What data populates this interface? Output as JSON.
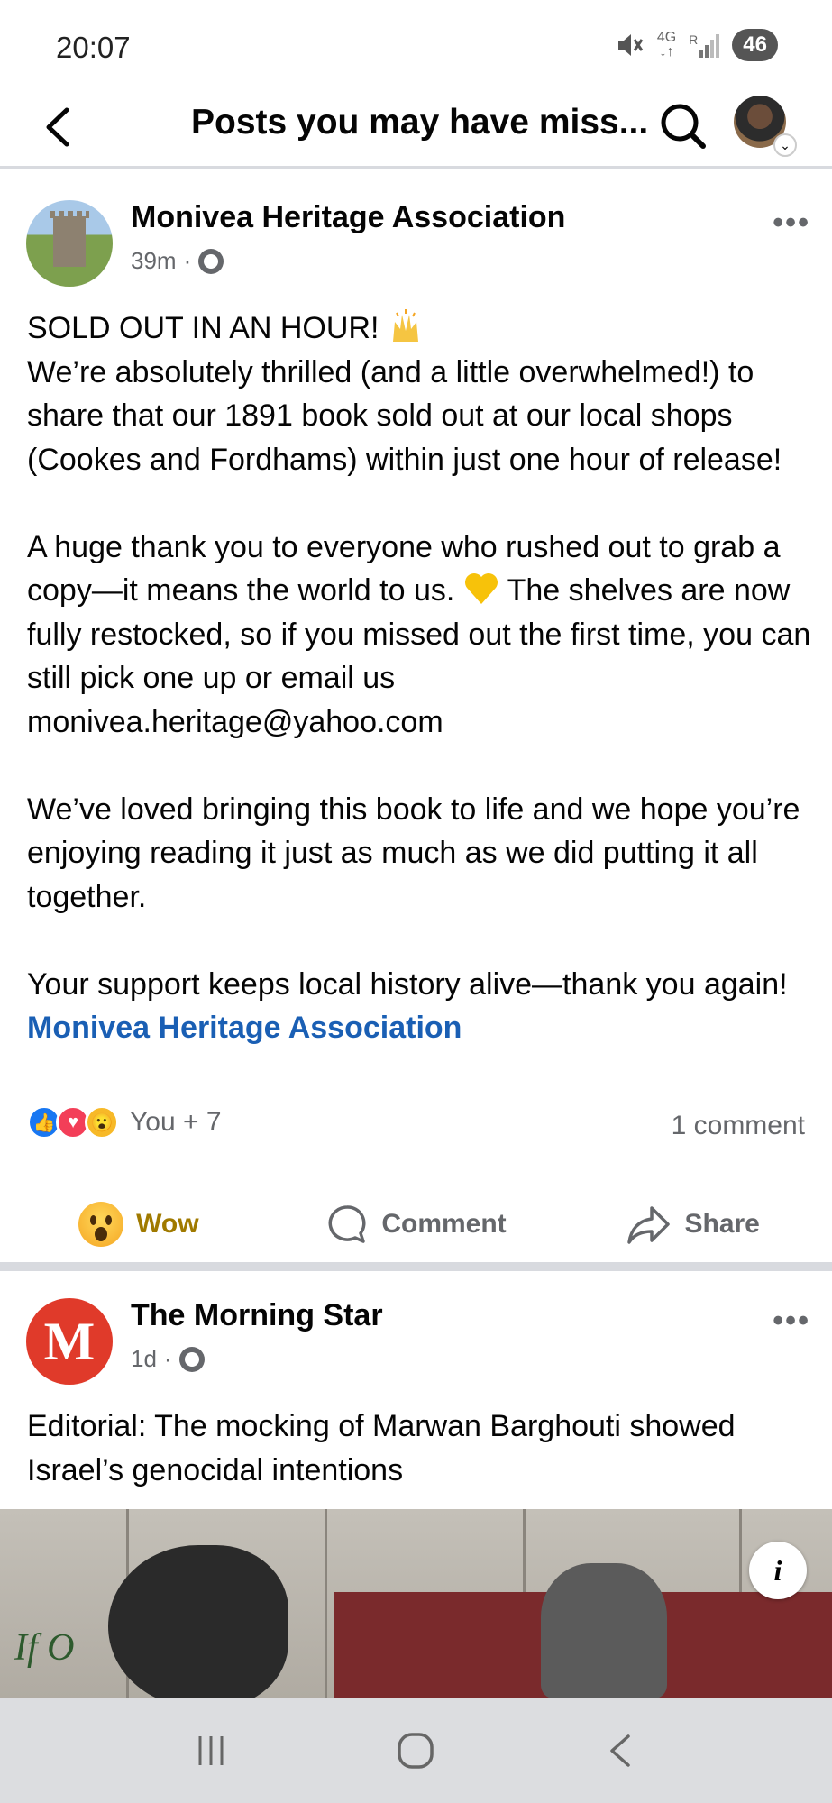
{
  "status_bar": {
    "time": "20:07",
    "network": "4G",
    "carrier_flag": "R",
    "battery": "46",
    "icons": [
      "mute-icon",
      "signal-icon",
      "battery-icon"
    ]
  },
  "header": {
    "title": "Posts you may have miss...",
    "back_icon": "back-arrow-icon",
    "search_icon": "search-icon"
  },
  "posts": [
    {
      "author": "Monivea Heritage Association",
      "time": "39m",
      "separator": "·",
      "paragraphs": [
        "SOLD OUT IN AN HOUR!",
        "We’re absolutely thrilled (and a little overwhelmed!) to share that our 1891 book sold out at our local shops (Cookes and Fordhams) within just one hour of release!",
        "",
        "A huge thank you to everyone who rushed out to grab a copy—it means the world to us.",
        "The shelves are now fully restocked, so if you missed out the first time, you can still pick one up or email us monivea.heritage@yahoo.com",
        "",
        "We’ve loved bringing this book to life and we hope you’re enjoying reading it just as much as we did putting it all together.",
        "",
        "Your support keeps local history alive—thank you again!"
      ],
      "tag": "Monivea Heritage Association",
      "reactions_label": "You + 7",
      "comments_label": "1 comment",
      "actions": {
        "react": "Wow",
        "comment": "Comment",
        "share": "Share"
      }
    },
    {
      "author": "The Morning Star",
      "time": "1d",
      "separator": "·",
      "text": "Editorial: The mocking of Marwan Barghouti showed Israel’s genocidal intentions",
      "logo_letter": "M",
      "image_graffiti": "If O",
      "info_label": "i"
    }
  ],
  "colors": {
    "link": "#1a5fb4",
    "wow_active": "#a07a00",
    "muted": "#65676b"
  }
}
